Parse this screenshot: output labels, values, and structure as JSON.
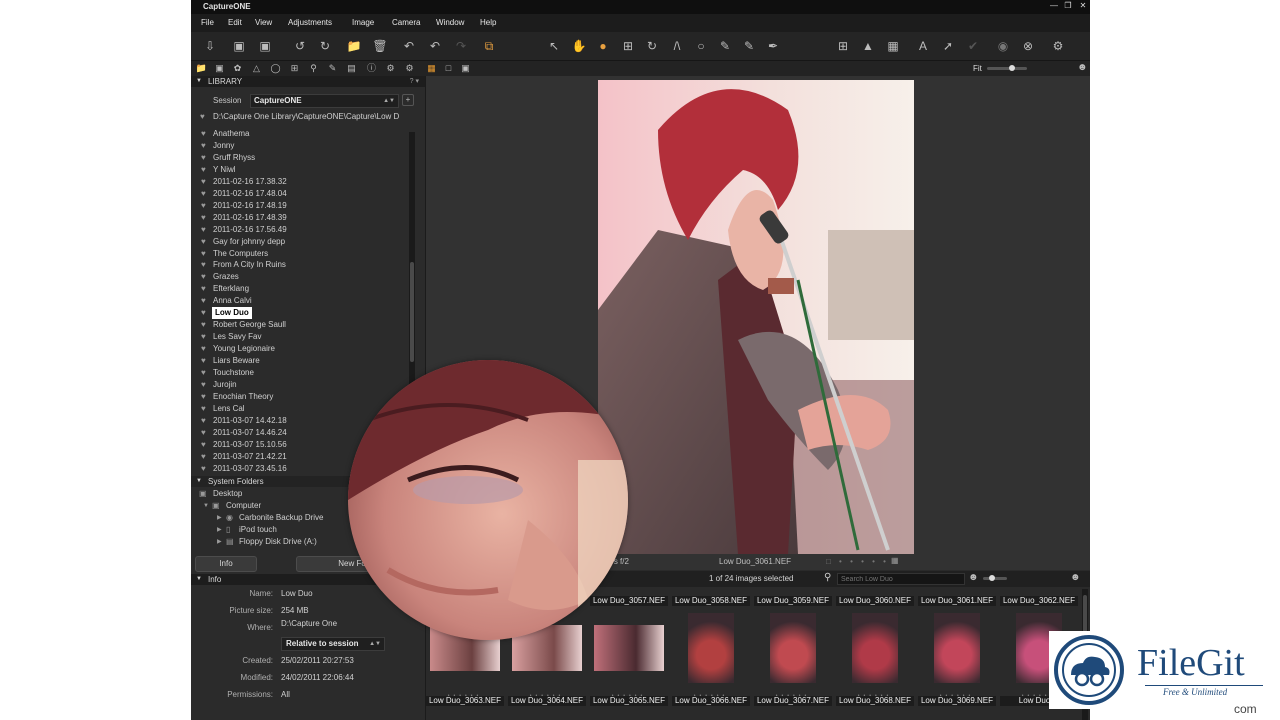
{
  "window": {
    "title": "CaptureONE"
  },
  "menu": [
    "File",
    "Edit",
    "View",
    "Adjustments",
    "Image",
    "Camera",
    "Window",
    "Help"
  ],
  "zoom": {
    "label": "Fit"
  },
  "library": {
    "header": "LIBRARY",
    "session_label": "Session",
    "session_value": "CaptureONE",
    "path": "D:\\Capture One Library\\CaptureONE\\Capture\\Low D",
    "albums": [
      "Anathema",
      "Jonny",
      "Gruff Rhyss",
      "Y Niwl",
      "2011-02-16 17.38.32",
      "2011-02-16 17.48.04",
      "2011-02-16 17.48.19",
      "2011-02-16 17.48.39",
      "2011-02-16 17.56.49",
      "Gay for johnny depp",
      "The Computers",
      "From A City In Ruins",
      "Grazes",
      "Efterklang",
      "Anna Calvi",
      "Low Duo",
      "Robert George Saull",
      "Les Savy Fav",
      "Young Legionaire",
      "Liars Beware",
      "Touchstone",
      "Jurojin",
      "Enochian Theory",
      "Lens Cal",
      "2011-03-07 14.42.18",
      "2011-03-07 14.46.24",
      "2011-03-07 15.10.56",
      "2011-03-07 21.42.21",
      "2011-03-07 23.45.16"
    ],
    "selected_album": "Low Duo",
    "system_folders_header": "System Folders",
    "folders": [
      {
        "label": "Desktop",
        "icon": "desktop-icon"
      },
      {
        "label": "Computer",
        "icon": "computer-icon"
      },
      {
        "label": "Carbonite Backup Drive",
        "icon": "drive-icon"
      },
      {
        "label": "iPod touch",
        "icon": "ipod-icon"
      },
      {
        "label": "Floppy Disk Drive (A:)",
        "icon": "floppy-icon"
      }
    ],
    "info_button": "Info",
    "new_folder_button": "New Fo"
  },
  "info_panel": {
    "header": "Info",
    "fields": [
      {
        "label": "Name:",
        "value": "Low Duo"
      },
      {
        "label": "Picture size:",
        "value": "254 MB"
      },
      {
        "label": "Where:",
        "value": "D:\\Capture One"
      },
      {
        "label": "Created:",
        "value": "25/02/2011 20:27:53"
      },
      {
        "label": "Modified:",
        "value": "24/02/2011 22:06:44"
      },
      {
        "label": "Permissions:",
        "value": "All"
      }
    ],
    "relative_select": "Relative to session"
  },
  "viewer": {
    "exif": "3200  1/40 s  f/2",
    "filename": "Low Duo_3061.NEF"
  },
  "browser": {
    "selection_text": "1 of 24 images selected",
    "search_placeholder": "Search Low Duo",
    "row1_names": [
      "Low Duo_3057.NEF",
      "Low Duo_3058.NEF",
      "Low Duo_3059.NEF",
      "Low Duo_3060.NEF",
      "Low Duo_3061.NEF",
      "Low Duo_3062.NEF"
    ],
    "row2_names": [
      "Low Duo_3063.NEF",
      "Low Duo_3064.NEF",
      "Low Duo_3065.NEF",
      "Low Duo_3066.NEF",
      "Low Duo_3067.NEF",
      "Low Duo_3068.NEF",
      "Low Duo_3069.NEF",
      "Low Duo_3"
    ]
  },
  "watermark": {
    "brand": "FileGit",
    "tagline": "Free & Unlimited",
    "tail": "com"
  },
  "colors": {
    "accent": "#e89a30",
    "panel": "#2b2b2b",
    "selected_bg": "#ffffff"
  }
}
